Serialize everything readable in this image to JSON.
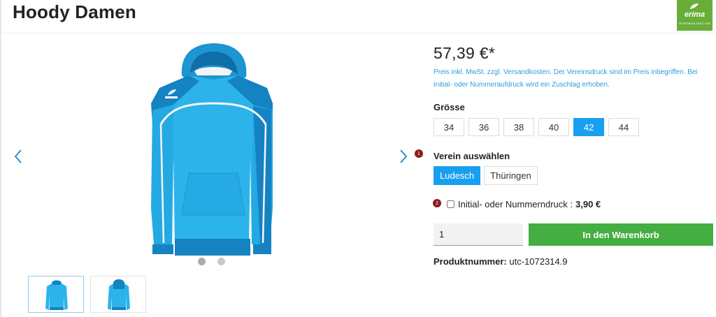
{
  "product": {
    "title": "Hoody Damen",
    "price": "57,39 €*",
    "price_note": "Preis inkl. MwSt. zzgl. Versandkosten. Der Vereinsdruck sind im Preis inbegriffen. Bei Initial- oder Nummeraufdruck wird ein Zuschlag erhoben.",
    "number_label": "Produktnummer:",
    "number_value": "utc-1072314.9"
  },
  "brand": {
    "logo_word": "erima",
    "logo_tagline": "SPORTWEAR SINCE 1900",
    "color": "#6aae3a"
  },
  "size": {
    "label": "Grösse",
    "options": [
      "34",
      "36",
      "38",
      "40",
      "42",
      "44"
    ],
    "selected": "42"
  },
  "club": {
    "badge": "1",
    "label": "Verein auswählen",
    "options": [
      "Ludesch",
      "Thüringen"
    ],
    "selected": "Ludesch"
  },
  "print_option": {
    "badge": "2",
    "label": "Initial- oder Nummerndruck :",
    "price": "3,90 €",
    "checked": false
  },
  "cart": {
    "quantity": "1",
    "button_label": "In den Warenkorb",
    "button_color": "#44ae42"
  },
  "gallery": {
    "slides": 2,
    "active_slide": 1,
    "thumbnails": 2,
    "accent": "#199ff0"
  }
}
